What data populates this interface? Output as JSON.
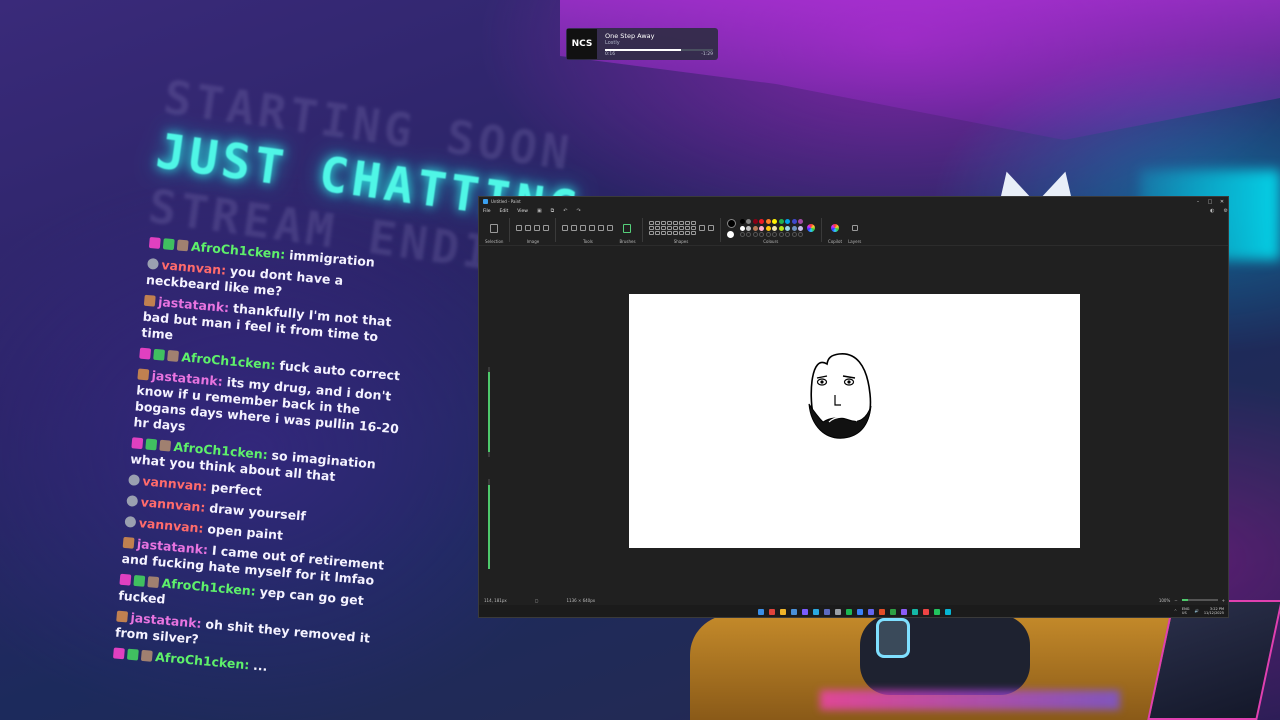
{
  "overlay": {
    "starting_line1": "STARTING SOON",
    "starting_line2": "JUST CHATTING",
    "starting_line3": "STREAM ENDING"
  },
  "now_playing": {
    "logo": "NCS",
    "title": "One Step Away",
    "artist": "Lostly",
    "elapsed": "0:16",
    "remaining": "-1:29",
    "progress": 0.7
  },
  "chat": [
    {
      "user": "AfroCh1cken",
      "color": "green",
      "badges": [
        "heart",
        "check",
        "cat"
      ],
      "text": "immigration"
    },
    {
      "user": "vannvan",
      "color": "red",
      "badges": [
        "gray"
      ],
      "text": "you dont have a neckbeard like me?"
    },
    {
      "user": "jastatank",
      "color": "pink",
      "badges": [
        "lego"
      ],
      "text": "thankfully I'm not that bad but man i feel it from time to time"
    },
    {
      "user": "AfroCh1cken",
      "color": "green",
      "badges": [
        "heart",
        "check",
        "cat"
      ],
      "text": "fuck auto correct"
    },
    {
      "user": "jastatank",
      "color": "pink",
      "badges": [
        "lego"
      ],
      "text": "its my drug, and i don't know if u remember back in the bogans days where i was pullin 16-20 hr days"
    },
    {
      "user": "AfroCh1cken",
      "color": "green",
      "badges": [
        "heart",
        "check",
        "cat"
      ],
      "text": "so imagination what you think about all that"
    },
    {
      "user": "vannvan",
      "color": "red",
      "badges": [
        "gray"
      ],
      "text": "perfect"
    },
    {
      "user": "vannvan",
      "color": "red",
      "badges": [
        "gray"
      ],
      "text": "draw yourself"
    },
    {
      "user": "vannvan",
      "color": "red",
      "badges": [
        "gray"
      ],
      "text": "open paint"
    },
    {
      "user": "jastatank",
      "color": "pink",
      "badges": [
        "lego"
      ],
      "text": "I came out of retirement and fucking hate myself for it lmfao"
    },
    {
      "user": "AfroCh1cken",
      "color": "green",
      "badges": [
        "heart",
        "check",
        "cat"
      ],
      "text": "yep can go get fucked"
    },
    {
      "user": "jastatank",
      "color": "pink",
      "badges": [
        "lego"
      ],
      "text": "oh shit they removed it from silver?"
    },
    {
      "user": "AfroCh1cken",
      "color": "green",
      "badges": [
        "heart",
        "check",
        "cat"
      ],
      "text": "..."
    }
  ],
  "paint": {
    "title": "Untitled - Paint",
    "menu": [
      "File",
      "Edit",
      "View"
    ],
    "ribbon_groups": [
      "Selection",
      "Image",
      "Tools",
      "Brushes",
      "Shapes",
      "Colours",
      "Copilot",
      "Layers"
    ],
    "swatch_colors": [
      "#000000",
      "#7f7f7f",
      "#880015",
      "#ed1c24",
      "#ff7f27",
      "#fff200",
      "#22b14c",
      "#00a2e8",
      "#3f48cc",
      "#a349a4",
      "#ffffff",
      "#c3c3c3",
      "#b97a57",
      "#ffaec9",
      "#ffc90e",
      "#efe4b0",
      "#b5e61d",
      "#99d9ea",
      "#7092be",
      "#c8bfe7",
      "#202020",
      "#202020",
      "#202020",
      "#202020",
      "#202020",
      "#202020",
      "#202020",
      "#202020",
      "#202020",
      "#202020"
    ],
    "status": {
      "cursor_pos": "114, 181px",
      "selection": "",
      "canvas_size": "1136 × 640px",
      "zoom": "100%"
    }
  },
  "taskbar": {
    "lang": "ENG",
    "region": "US",
    "time": "3:22 PM",
    "date": "11/12/2025"
  }
}
